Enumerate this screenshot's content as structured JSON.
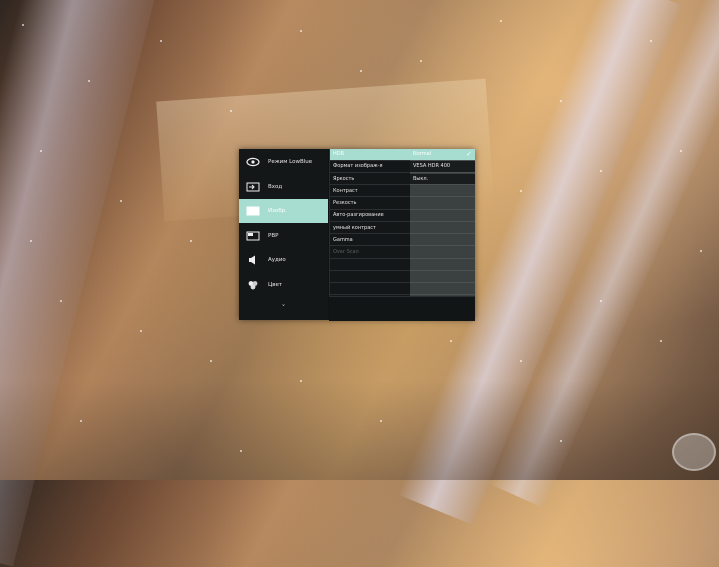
{
  "osd": {
    "nav": [
      {
        "label": "Режим LowBlue",
        "icon": "eye-icon"
      },
      {
        "label": "Вход",
        "icon": "input-icon"
      },
      {
        "label": "Изобр.",
        "icon": "picture-icon",
        "active": true
      },
      {
        "label": "PBP",
        "icon": "pbp-icon"
      },
      {
        "label": "Аудио",
        "icon": "speaker-icon"
      },
      {
        "label": "Цвет",
        "icon": "color-icon"
      }
    ],
    "more_label": "˅",
    "submenu": [
      {
        "label": "HDR",
        "active": true
      },
      {
        "label": "Формат изображ-я"
      },
      {
        "label": "Яркость"
      },
      {
        "label": "Контраст"
      },
      {
        "label": "Резкость"
      },
      {
        "label": "Авто-разгирование"
      },
      {
        "label": "умный контраст"
      },
      {
        "label": "Gamma"
      },
      {
        "label": "Over Scan",
        "dim": true
      },
      {
        "label": ""
      },
      {
        "label": ""
      },
      {
        "label": ""
      }
    ],
    "options": [
      {
        "label": "Normal",
        "checked": true
      },
      {
        "label": "VESA HDR 400"
      },
      {
        "label": "Выкл."
      },
      {
        "label": ""
      },
      {
        "label": ""
      },
      {
        "label": ""
      },
      {
        "label": ""
      },
      {
        "label": ""
      },
      {
        "label": ""
      },
      {
        "label": ""
      },
      {
        "label": ""
      },
      {
        "label": ""
      }
    ],
    "accent": "#a6ddd0",
    "bg": "#141718"
  }
}
